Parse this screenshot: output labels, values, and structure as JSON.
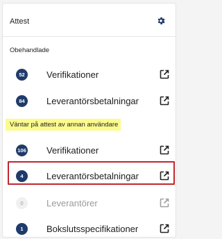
{
  "header": {
    "title": "Attest"
  },
  "sections": [
    {
      "label": "Obehandlade",
      "highlighted": false,
      "items": [
        {
          "count": "52",
          "label": "Verifikationer",
          "muted": false
        },
        {
          "count": "84",
          "label": "Leverantörsbetalningar",
          "muted": false
        }
      ]
    },
    {
      "label": "Väntar på attest av annan användare",
      "highlighted": true,
      "items": [
        {
          "count": "106",
          "label": "Verifikationer",
          "muted": false
        },
        {
          "count": "4",
          "label": "Leverantörsbetalningar",
          "muted": false,
          "selected": true
        },
        {
          "count": "0",
          "label": "Leverantörer",
          "muted": true
        },
        {
          "count": "1",
          "label": "Bokslutsspecifikationer",
          "muted": false
        }
      ]
    }
  ],
  "colors": {
    "badge": "#1f3b6b",
    "highlight": "#fbfb8e",
    "selection_border": "#c0262c",
    "muted_text": "#9a9a9a"
  },
  "icons": {
    "settings": "gear-icon",
    "open": "external-link-icon"
  }
}
